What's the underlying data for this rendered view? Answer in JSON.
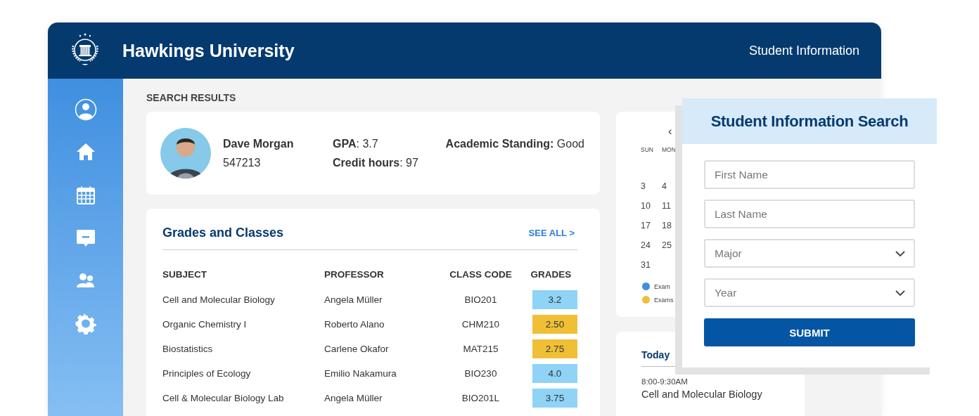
{
  "header": {
    "title": "Hawkings University",
    "section": "Student Information"
  },
  "sidebar": {
    "items": [
      {
        "kind": "profile",
        "selected": false
      },
      {
        "kind": "home",
        "selected": false
      },
      {
        "kind": "calendar",
        "selected": false
      },
      {
        "kind": "message",
        "selected": false
      },
      {
        "kind": "people",
        "selected": false
      },
      {
        "kind": "settings",
        "selected": false
      }
    ]
  },
  "results_label": "SEARCH RESULTS",
  "student": {
    "name": "Dave Morgan",
    "id": "547213",
    "gpa": "**GPA**: 3.7",
    "credits": "**Credit hours**: 97",
    "standing": "**Academic Standing:** Good"
  },
  "grades": {
    "title": "Grades and Classes",
    "see_all": "SEE ALL >",
    "columns": [
      "SUBJECT",
      "PROFESSOR",
      "CLASS CODE",
      "GRADES"
    ],
    "rows": [
      {
        "subject": "Cell and Molecular Biology",
        "professor": "Angela Müller",
        "code": "BIO201",
        "grade": "3.2",
        "color": "#8fd3f7"
      },
      {
        "subject": "Organic Chemistry I",
        "professor": "Roberto Alano",
        "code": "CHM210",
        "grade": "2.50",
        "color": "#f0bf36"
      },
      {
        "subject": "Biostatistics",
        "professor": "Carlene Okafor",
        "code": "MAT215",
        "grade": "2.75",
        "color": "#f0bf36"
      },
      {
        "subject": "Principles of Ecology",
        "professor": "Emilio Nakamura",
        "code": "BIO230",
        "grade": "4.0",
        "color": "#8fd3f7"
      },
      {
        "subject": "Cell & Molecular Biology Lab",
        "professor": "Angela Müller",
        "code": "BIO201L",
        "grade": "3.75",
        "color": "#8fd3f7"
      }
    ]
  },
  "calendar": {
    "prev": "‹",
    "weekdays": [
      "SUN",
      "MON"
    ],
    "weeks": [
      [
        "3",
        "4"
      ],
      [
        "10",
        "11"
      ],
      [
        "17",
        "18"
      ],
      [
        "24",
        "25"
      ],
      [
        "31"
      ]
    ],
    "legend": [
      {
        "label": "Exam",
        "color": "#3d8fe0"
      },
      {
        "label": "Exams",
        "color": "#f0bf36"
      }
    ]
  },
  "schedule": {
    "heading": "Today",
    "events": [
      {
        "time": "8:00-9:30AM",
        "title": "Cell and Molecular Biology"
      }
    ]
  },
  "search": {
    "title": "Student Information Search",
    "fields": [
      {
        "kind": "text",
        "placeholder": "First Name"
      },
      {
        "kind": "text",
        "placeholder": "Last Name"
      },
      {
        "kind": "select",
        "placeholder": "Major"
      },
      {
        "kind": "select",
        "placeholder": "Year"
      }
    ],
    "submit": "SUBMIT"
  }
}
